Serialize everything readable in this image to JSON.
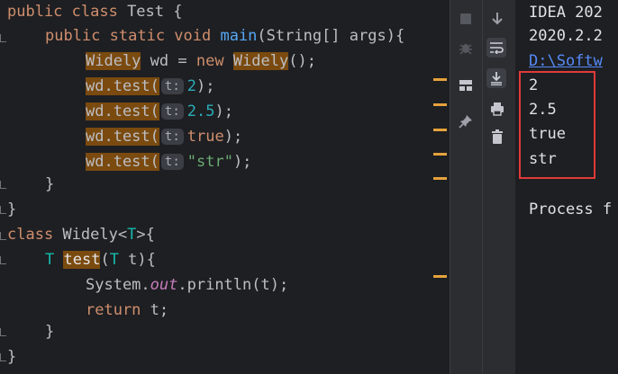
{
  "code_lines": [
    [
      "public class Test {"
    ],
    [
      "public static void main(String[] args){"
    ],
    [
      "Widely wd = new Widely();"
    ],
    [
      "wd.test(",
      "t:",
      "2);"
    ],
    [
      "wd.test(",
      "t:",
      "2.5);"
    ],
    [
      "wd.test(",
      "t:",
      "true);"
    ],
    [
      "wd.test(",
      "t:",
      "\"str\");"
    ],
    [
      "}"
    ],
    [
      "}"
    ],
    [
      "class Widely<T>{"
    ],
    [
      "T test(T t){"
    ],
    [
      "System.out.println(t);"
    ],
    [
      "return t;"
    ],
    [
      "}"
    ],
    [
      "}"
    ]
  ],
  "console": {
    "header_line1": "IDEA 202",
    "header_line2": "2020.2.2",
    "path_link": "D:\\Softw",
    "outputs": [
      "2",
      "2.5",
      "true",
      "str"
    ],
    "process_text": "Process f"
  },
  "toolbar": {
    "icons": [
      "stop-icon",
      "scroll-down-icon",
      "debug-icon",
      "soft-wrap-icon",
      "scroll-to-end-icon",
      "layout-icon",
      "print-icon",
      "pin-icon",
      "trash-icon"
    ]
  },
  "colors": {
    "editor_bg": "#1e1f22",
    "toolbar_bg": "#2b2d30",
    "keyword": "#cf8e6d",
    "highlight": "#7a4a0f",
    "error_stripe": "#e6a23c",
    "highlight_box": "#e03a3a",
    "link": "#548af7"
  }
}
